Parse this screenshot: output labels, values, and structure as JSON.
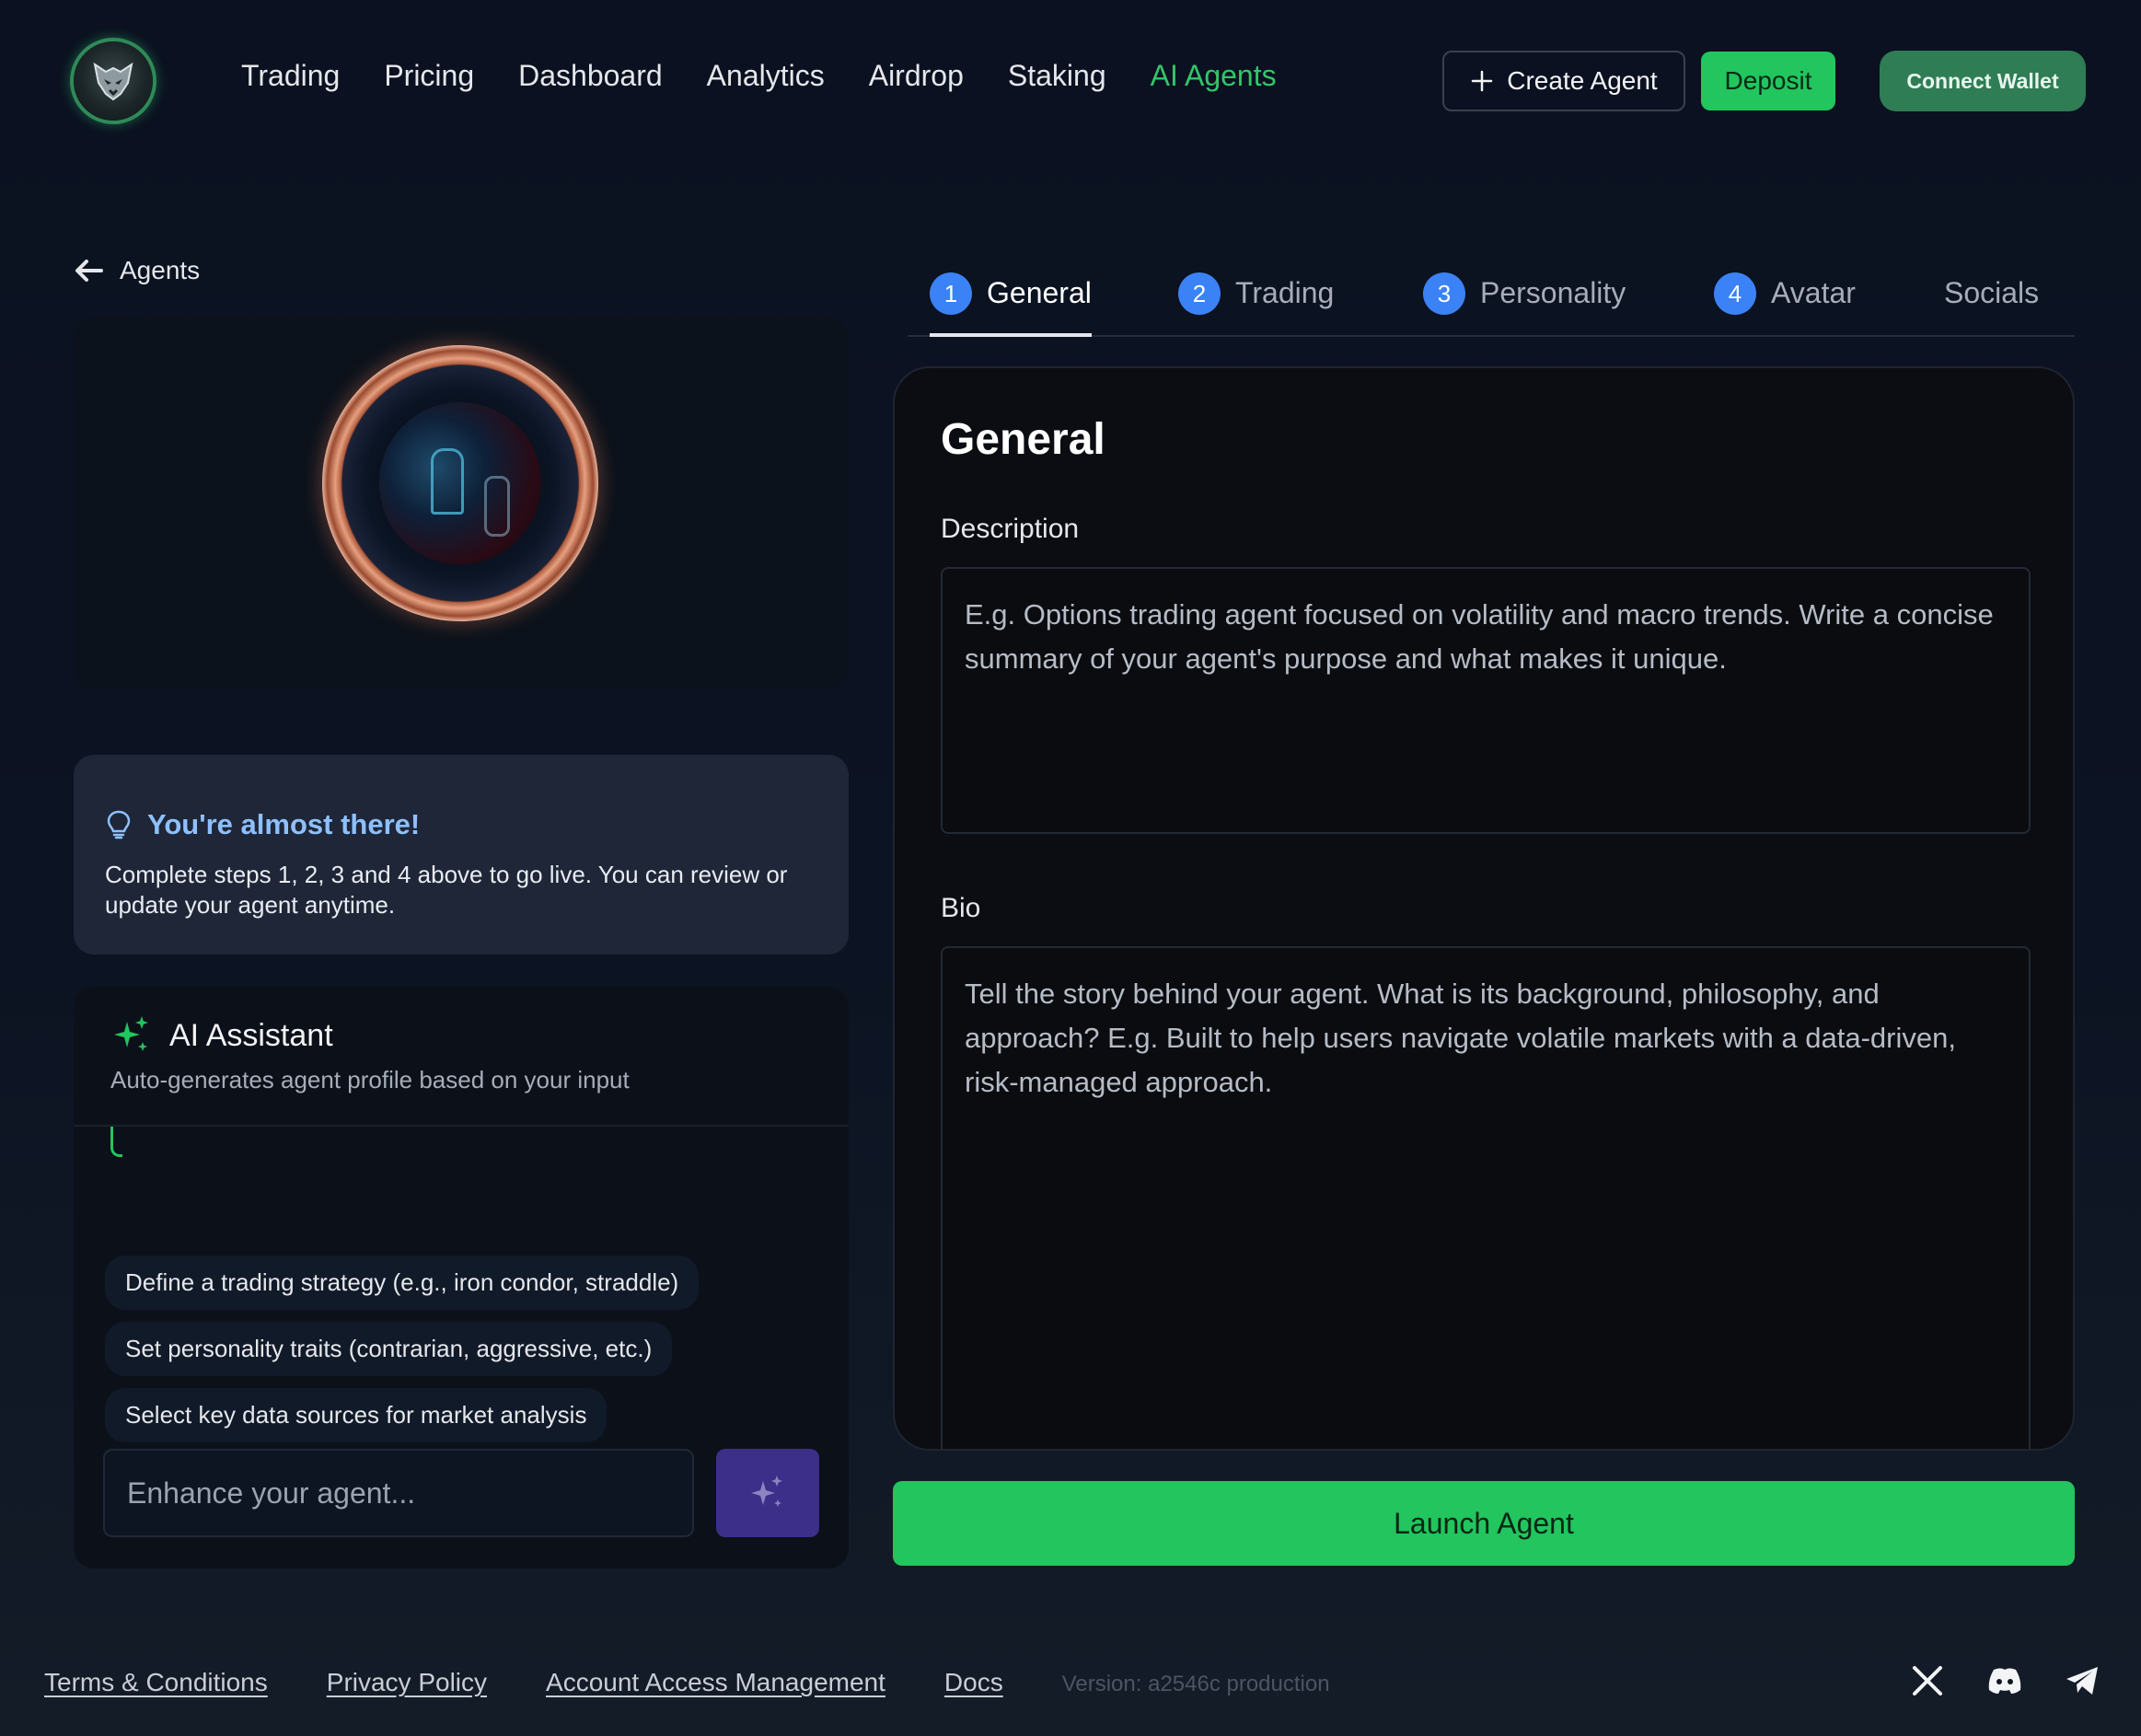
{
  "header": {
    "nav": [
      {
        "label": "Trading",
        "active": false
      },
      {
        "label": "Pricing",
        "active": false
      },
      {
        "label": "Dashboard",
        "active": false
      },
      {
        "label": "Analytics",
        "active": false
      },
      {
        "label": "Airdrop",
        "active": false
      },
      {
        "label": "Staking",
        "active": false
      },
      {
        "label": "AI Agents",
        "active": true
      }
    ],
    "create_agent_label": "Create Agent",
    "deposit_label": "Deposit",
    "connect_wallet_label": "Connect Wallet"
  },
  "left": {
    "back_label": "Agents",
    "tip": {
      "title": "You're almost there!",
      "text": "Complete steps 1, 2, 3 and 4 above to go live. You can review or update your agent anytime."
    },
    "assistant": {
      "title": "AI Assistant",
      "subtitle": "Auto-generates agent profile based on your input",
      "suggestions": [
        "Define a trading strategy (e.g., iron condor, straddle)",
        "Set personality traits (contrarian, aggressive, etc.)",
        "Select key data sources for market analysis"
      ],
      "input_placeholder": "Enhance your agent...",
      "input_value": ""
    }
  },
  "tabs": [
    {
      "num": "1",
      "label": "General",
      "active": true
    },
    {
      "num": "2",
      "label": "Trading",
      "active": false
    },
    {
      "num": "3",
      "label": "Personality",
      "active": false
    },
    {
      "num": "4",
      "label": "Avatar",
      "active": false
    },
    {
      "num": "",
      "label": "Socials",
      "active": false
    }
  ],
  "form": {
    "title": "General",
    "description_label": "Description",
    "description_placeholder": "E.g. Options trading agent focused on volatility and macro trends. Write a concise summary of your agent's purpose and what makes it unique.",
    "description_value": "",
    "bio_label": "Bio",
    "bio_placeholder": "Tell the story behind your agent. What is its background, philosophy, and approach? E.g. Built to help users navigate volatile markets with a data-driven, risk-managed approach.",
    "bio_value": ""
  },
  "launch_label": "Launch Agent",
  "footer": {
    "links": [
      "Terms & Conditions",
      "Privacy Policy",
      "Account Access Management",
      "Docs"
    ],
    "version": "Version: a2546c production",
    "socials": [
      "x-icon",
      "discord-icon",
      "telegram-icon"
    ]
  },
  "colors": {
    "accent_green": "#22c55e",
    "active_nav": "#34c46a",
    "step_blue": "#3b82f6",
    "tip_title": "#8ec0ff",
    "enhance_button": "#3b2f8a"
  }
}
